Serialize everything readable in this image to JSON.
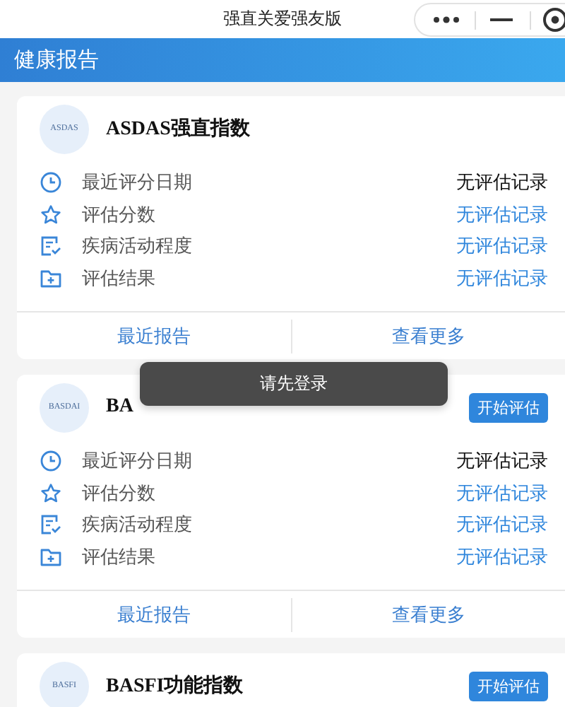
{
  "window": {
    "title": "强直关爱强友版"
  },
  "header": {
    "title": "健康报告"
  },
  "cards": [
    {
      "logo": "ASDAS",
      "title": "ASDAS强直指数",
      "rows": [
        {
          "label": "最近评分日期",
          "value": "无评估记录",
          "linked": false
        },
        {
          "label": "评估分数",
          "value": "无评估记录",
          "linked": true
        },
        {
          "label": "疾病活动程度",
          "value": "无评估记录",
          "linked": true
        },
        {
          "label": "评估结果",
          "value": "无评估记录",
          "linked": true
        }
      ],
      "actions": [
        "最近报告",
        "查看更多"
      ]
    },
    {
      "logo": "BASDAI",
      "title": "BA",
      "button": "开始评估",
      "rows": [
        {
          "label": "最近评分日期",
          "value": "无评估记录",
          "linked": false
        },
        {
          "label": "评估分数",
          "value": "无评估记录",
          "linked": true
        },
        {
          "label": "疾病活动程度",
          "value": "无评估记录",
          "linked": true
        },
        {
          "label": "评估结果",
          "value": "无评估记录",
          "linked": true
        }
      ],
      "actions": [
        "最近报告",
        "查看更多"
      ]
    },
    {
      "logo": "BASFI",
      "title": "BASFI功能指数",
      "button": "开始评估"
    }
  ],
  "toast": {
    "text": "请先登录"
  }
}
